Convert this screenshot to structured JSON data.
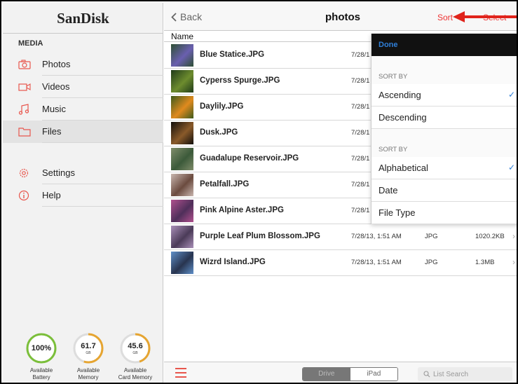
{
  "sidebar": {
    "brand": "SanDisk",
    "section": "MEDIA",
    "items": [
      {
        "label": "Photos",
        "icon": "camera-icon"
      },
      {
        "label": "Videos",
        "icon": "video-icon"
      },
      {
        "label": "Music",
        "icon": "music-icon"
      },
      {
        "label": "Files",
        "icon": "folder-icon"
      },
      {
        "label": "Settings",
        "icon": "gear-icon"
      },
      {
        "label": "Help",
        "icon": "info-icon"
      }
    ],
    "selected": "Files",
    "gauges": [
      {
        "value": "100%",
        "unit": "",
        "caption1": "Available",
        "caption2": "Battery",
        "level": 1.0
      },
      {
        "value": "61.7",
        "unit": "GB",
        "caption1": "Available",
        "caption2": "Memory",
        "level": 0.55
      },
      {
        "value": "45.6",
        "unit": "GB",
        "caption1": "Available",
        "caption2": "Card Memory",
        "level": 0.45
      }
    ]
  },
  "navbar": {
    "back_label": "Back",
    "title": "photos",
    "sort_label": "Sort",
    "select_label": "Select"
  },
  "table": {
    "name_header": "Name",
    "rows": [
      {
        "name": "Blue Statice.JPG",
        "date": "7/28/1",
        "type": "",
        "size": "",
        "thumb": [
          "#2e4f33",
          "#6a5fb0"
        ]
      },
      {
        "name": "Cyperss Spurge.JPG",
        "date": "7/28/1",
        "type": "",
        "size": "",
        "thumb": [
          "#1f3a1a",
          "#6d8c2e"
        ]
      },
      {
        "name": "Daylily.JPG",
        "date": "7/28/1",
        "type": "",
        "size": "",
        "thumb": [
          "#3d5a1c",
          "#e08a1e"
        ]
      },
      {
        "name": "Dusk.JPG",
        "date": "7/28/1",
        "type": "",
        "size": "",
        "thumb": [
          "#120f0c",
          "#8a5a2a"
        ]
      },
      {
        "name": "Guadalupe Reservoir.JPG",
        "date": "7/28/1",
        "type": "",
        "size": "",
        "thumb": [
          "#7f8c6a",
          "#3c5a3a"
        ]
      },
      {
        "name": "Petalfall.JPG",
        "date": "7/28/1",
        "type": "",
        "size": "",
        "thumb": [
          "#c9b7b0",
          "#6b4b3f"
        ]
      },
      {
        "name": "Pink Alpine Aster.JPG",
        "date": "7/28/1",
        "type": "",
        "size": "",
        "thumb": [
          "#b0508e",
          "#4f2f5a"
        ]
      },
      {
        "name": "Purple Leaf Plum Blossom.JPG",
        "date": "7/28/13, 1:51 AM",
        "type": "JPG",
        "size": "1020.2KB",
        "thumb": [
          "#a98fb8",
          "#4b3b58"
        ]
      },
      {
        "name": "Wizrd Island.JPG",
        "date": "7/28/13, 1:51 AM",
        "type": "JPG",
        "size": "1.3MB",
        "thumb": [
          "#5f8fc8",
          "#28344f"
        ]
      }
    ]
  },
  "toolbar": {
    "segments": [
      "Drive",
      "iPad"
    ],
    "active_segment": "Drive",
    "search_placeholder": "List Search"
  },
  "popover": {
    "done_label": "Done",
    "sections": [
      {
        "header": "SORT BY",
        "options": [
          "Ascending",
          "Descending"
        ],
        "selected": "Ascending"
      },
      {
        "header": "SORT BY",
        "options": [
          "Alphabetical",
          "Date",
          "File Type"
        ],
        "selected": "Alphabetical"
      }
    ]
  },
  "colors": {
    "accent": "#e8564d",
    "link_blue": "#2f7fd8",
    "annotation_arrow": "#e0231b"
  }
}
